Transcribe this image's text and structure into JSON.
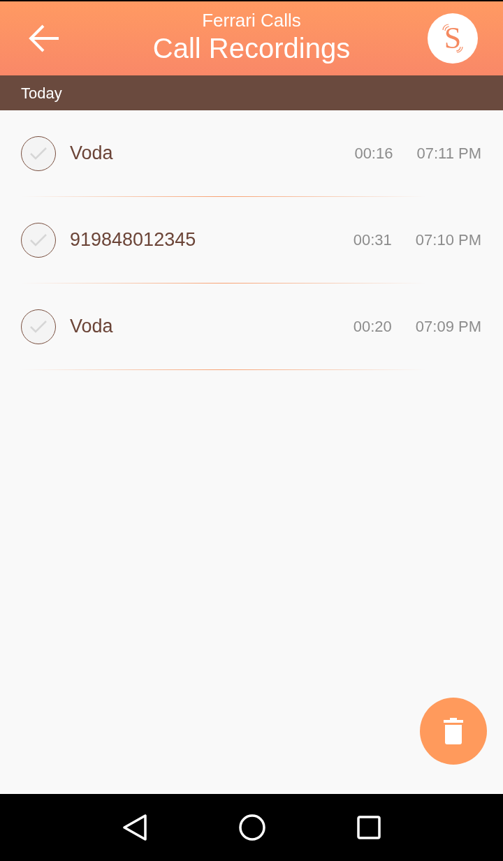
{
  "app_bar": {
    "subtitle": "Ferrari Calls",
    "title": "Call Recordings",
    "logo_letter": "S"
  },
  "section": {
    "label": "Today"
  },
  "recordings": [
    {
      "name": "Voda",
      "checked": false,
      "duration": "00:16",
      "time": "07:11 PM"
    },
    {
      "name": "919848012345",
      "checked": false,
      "duration": "00:31",
      "time": "07:10 PM"
    },
    {
      "name": "Voda",
      "checked": false,
      "duration": "00:20",
      "time": "07:09 PM"
    }
  ]
}
